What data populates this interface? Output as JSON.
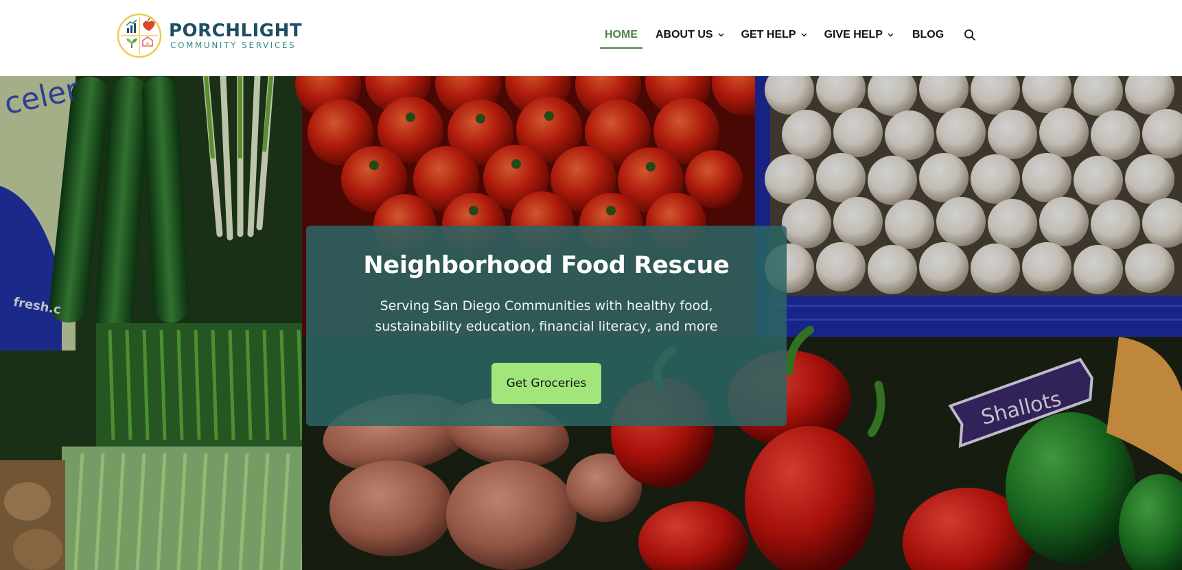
{
  "brand": {
    "title": "PORCHLIGHT",
    "subtitle": "COMMUNITY SERVICES",
    "logo_icon": "porchlight-logo-icon",
    "colors": {
      "title": "#1f4e63",
      "subtitle": "#2a8f86",
      "ring": "#f2c94c"
    }
  },
  "nav": {
    "items": [
      {
        "label": "HOME",
        "active": true,
        "dropdown": false
      },
      {
        "label": "ABOUT US",
        "active": false,
        "dropdown": true
      },
      {
        "label": "GET HELP",
        "active": false,
        "dropdown": true
      },
      {
        "label": "GIVE HELP",
        "active": false,
        "dropdown": true
      },
      {
        "label": "BLOG",
        "active": false,
        "dropdown": false
      }
    ],
    "active_color": "#4d7f4a",
    "search_icon": "search-icon",
    "dropdown_icon": "chevron-down-icon"
  },
  "hero": {
    "title": "Neighborhood Food Rescue",
    "subtitle": "Serving San Diego Communities with healthy food, sustainability education, financial literacy, and more",
    "cta_label": "Get Groceries",
    "card_color": "#2b6564",
    "cta_color": "#a1e57b",
    "background": "produce-photo",
    "photo_sign_text": "Shallots",
    "photo_bag_text": "celer",
    "photo_bag_text_2": "fresh.c"
  }
}
